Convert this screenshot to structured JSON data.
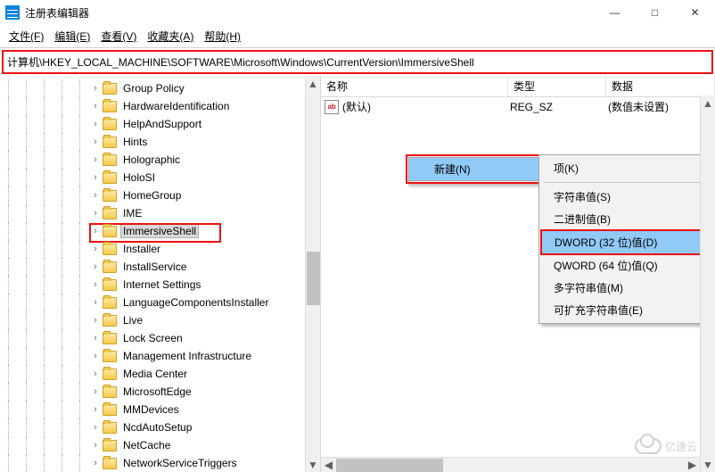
{
  "window": {
    "title": "注册表编辑器",
    "min": "—",
    "max": "□",
    "close": "✕"
  },
  "menu": {
    "file": "文件(F)",
    "edit": "编辑(E)",
    "view": "查看(V)",
    "favorites": "收藏夹(A)",
    "help": "帮助(H)"
  },
  "address": "计算机\\HKEY_LOCAL_MACHINE\\SOFTWARE\\Microsoft\\Windows\\CurrentVersion\\ImmersiveShell",
  "tree": [
    "Group Policy",
    "HardwareIdentification",
    "HelpAndSupport",
    "Hints",
    "Holographic",
    "HoloSI",
    "HomeGroup",
    "IME",
    "ImmersiveShell",
    "Installer",
    "InstallService",
    "Internet Settings",
    "LanguageComponentsInstaller",
    "Live",
    "Lock Screen",
    "Management Infrastructure",
    "Media Center",
    "MicrosoftEdge",
    "MMDevices",
    "NcdAutoSetup",
    "NetCache",
    "NetworkServiceTriggers"
  ],
  "tree_selected_index": 8,
  "columns": {
    "name": "名称",
    "type": "类型",
    "data": "数据"
  },
  "row": {
    "name": "(默认)",
    "type": "REG_SZ",
    "data": "(数值未设置)"
  },
  "ctx1": {
    "new": "新建(N)"
  },
  "ctx2": {
    "key": "项(K)",
    "string": "字符串值(S)",
    "binary": "二进制值(B)",
    "dword": "DWORD (32 位)值(D)",
    "qword": "QWORD (64 位)值(Q)",
    "multi": "多字符串值(M)",
    "expand": "可扩充字符串值(E)"
  },
  "watermark": "亿速云"
}
